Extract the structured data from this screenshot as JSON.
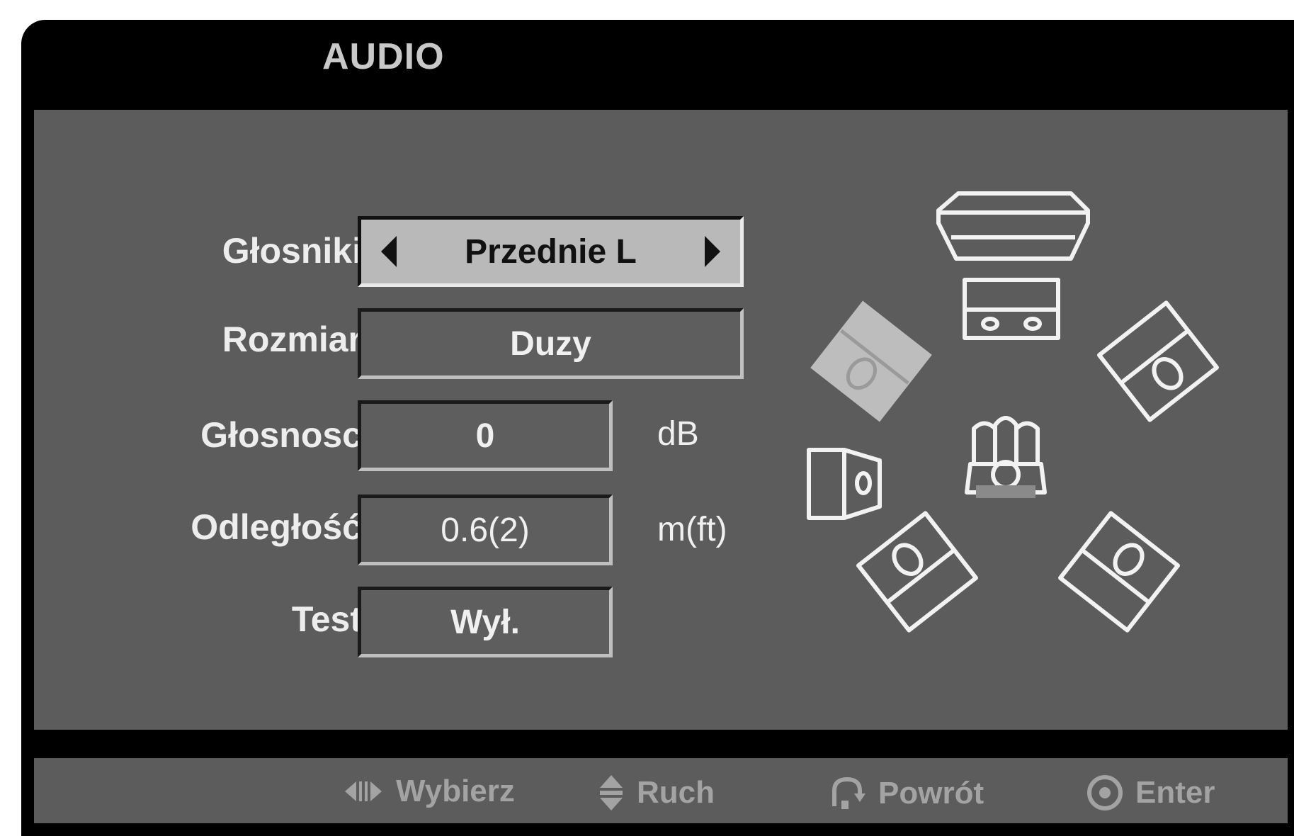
{
  "menu": {
    "title": "AUDIO"
  },
  "settings": {
    "speakers": {
      "label": "Głosniki",
      "value": "Przednie L"
    },
    "size": {
      "label": "Rozmiar",
      "value": "Duzy"
    },
    "volume": {
      "label": "Głosnosc",
      "value": "0",
      "unit": "dB"
    },
    "distance": {
      "label": "Odległość",
      "value": "0.6(2)",
      "unit": "m(ft)"
    },
    "test": {
      "label": "Test",
      "value": "Wył."
    }
  },
  "speaker_diagram": {
    "selected": "front-left",
    "icons": [
      "tv-icon",
      "center-speaker-icon",
      "front-left-speaker-icon",
      "front-right-speaker-icon",
      "subwoofer-icon",
      "listener-icon",
      "surround-left-speaker-icon",
      "surround-right-speaker-icon"
    ]
  },
  "footer": {
    "select": {
      "icon": "left-right-icon",
      "label": "Wybierz"
    },
    "move": {
      "icon": "up-down-icon",
      "label": "Ruch"
    },
    "back": {
      "icon": "return-icon",
      "label": "Powrót"
    },
    "enter": {
      "icon": "enter-icon",
      "label": "Enter"
    }
  },
  "colors": {
    "background": "#5c5c5c",
    "frame": "#000000",
    "highlight": "#b9b9b9"
  }
}
